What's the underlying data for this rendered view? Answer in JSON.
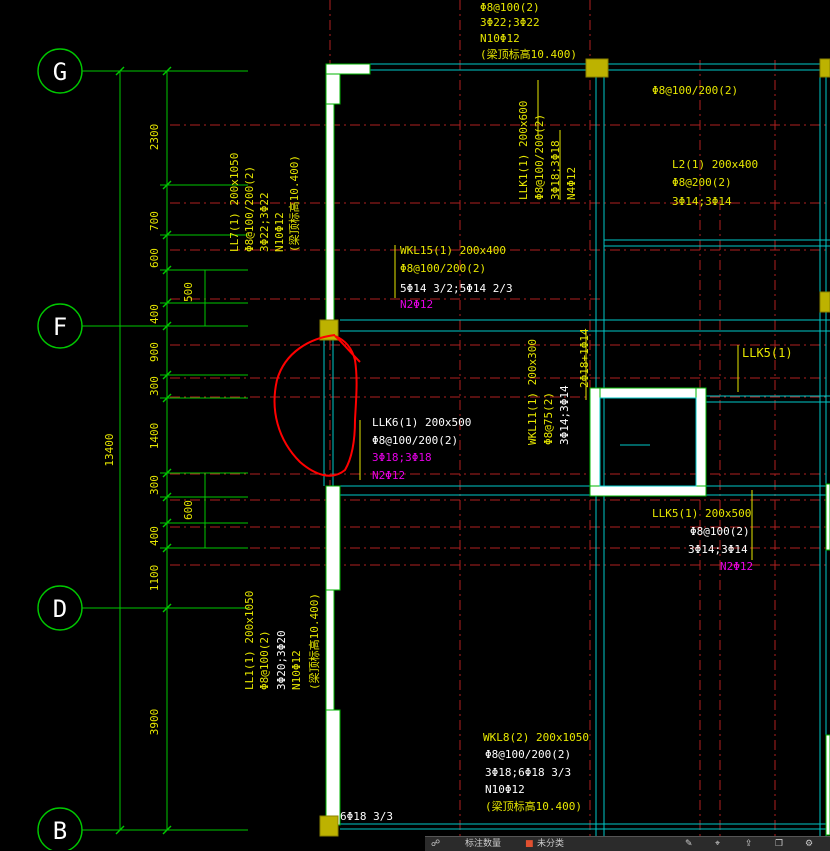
{
  "axes": {
    "G": {
      "label": "G"
    },
    "F": {
      "label": "F"
    },
    "D": {
      "label": "D"
    },
    "B": {
      "label": "B"
    }
  },
  "dims": {
    "total": "13400",
    "d2300": "2300",
    "d700": "700",
    "d600a": "600",
    "d400a": "400",
    "d500": "500",
    "d900": "900",
    "d300a": "300",
    "d1400": "1400",
    "d300b": "300",
    "d400b": "400",
    "d600b": "600",
    "d1100": "1100",
    "d3900": "3900"
  },
  "beams": {
    "top": {
      "l1": "Φ8@100(2)",
      "l2": "3Φ22;3Φ22",
      "l3": "N10Φ12",
      "l4": "(梁顶标高10.400)"
    },
    "top_right": {
      "stirrup": "Φ8@100/200(2)"
    },
    "ll7": {
      "l1": "LL7(1) 200x1050",
      "l2": "Φ8@100/200(2)",
      "l3": "3Φ22;3Φ22",
      "l4": "N10Φ12",
      "l5": "(梁顶标高10.400)"
    },
    "llk1": {
      "l1": "LLK1(1) 200x600",
      "l2": "Φ8@100/200(2)",
      "l3": "3Φ18;3Φ18",
      "l4": "N4Φ12"
    },
    "l2": {
      "l1": "L2(1) 200x400",
      "l2": "Φ8@200(2)",
      "l3": "3Φ14;3Φ14"
    },
    "wkl15": {
      "l1": "WKL15(1) 200x400",
      "l2": "Φ8@100/200(2)",
      "l3": "5Φ14 3/2;5Φ14 2/3",
      "l4": "N2Φ12"
    },
    "vert_2018": {
      "l1": "2Φ18+1Φ14"
    },
    "llk5_top": {
      "l1": "LLK5(1)"
    },
    "wkl11": {
      "l1": "WKL11(1) 200x300",
      "l2": "Φ8@75(2)",
      "l3": "3Φ14;3Φ14"
    },
    "llk6": {
      "l1": "LLK6(1) 200x500",
      "l2": "Φ8@100/200(2)",
      "l3": "3Φ18;3Φ18",
      "l4": "N2Φ12"
    },
    "llk5": {
      "l1": "LLK5(1) 200x500",
      "l2": "Φ8@100(2)",
      "l3": "3Φ14;3Φ14",
      "l4": "N2Φ12"
    },
    "ll1": {
      "l1": "LL1(1) 200x1050",
      "l2": "Φ8@100(2)",
      "l3": "3Φ20;3Φ20",
      "l4": "N10Φ12",
      "l5": "(梁顶标高10.400)"
    },
    "wkl8": {
      "l1": "WKL8(2) 200x1050",
      "l2": "Φ8@100/200(2)",
      "l3": "3Φ18;6Φ18 3/3",
      "l4": "N10Φ12",
      "l5": "(梁顶标高10.400)"
    },
    "bottom_left": {
      "l1": "6Φ18 3/3"
    }
  },
  "toolbar": {
    "item1": "标注数量",
    "item2": "未分类"
  },
  "colors": {
    "background": "#000000",
    "grid_axis": "#00c800",
    "wall_fill": "#ffffff",
    "wall_edge": "#00b400",
    "annotation": "#e6e600",
    "beam_line": "#00c8c8",
    "magenta": "#e600e6",
    "red_mark": "#ff0000",
    "column": "#bdb200"
  }
}
